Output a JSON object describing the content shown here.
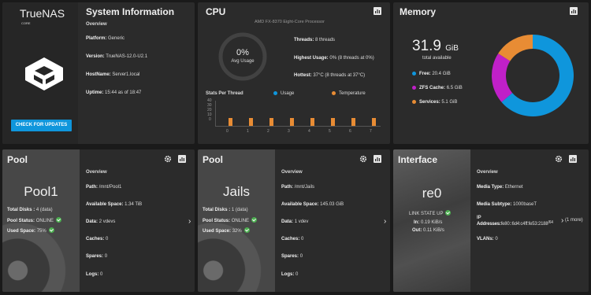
{
  "sysinfo": {
    "title": "System Information",
    "logo_text": "TrueNAS",
    "logo_sub": "CORE",
    "overview": "Overview",
    "platform_label": "Platform:",
    "platform": "Generic",
    "version_label": "Version:",
    "version": "TrueNAS-12.0-U2.1",
    "hostname_label": "HostName:",
    "hostname": "Server1.local",
    "uptime_label": "Uptime:",
    "uptime": "15:44 as of 18:47",
    "check_btn": "CHECK FOR UPDATES"
  },
  "cpu": {
    "title": "CPU",
    "processor": "AMD FX-8370 Eight-Core Processor",
    "gauge_value": "0%",
    "gauge_label": "Avg Usage",
    "threads_label": "Threads:",
    "threads": "8 threads",
    "highest_label": "Highest Usage:",
    "highest": "0%  (8 threads at 0%)",
    "hottest_label": "Hottest:",
    "hottest": "37°C  (8 threads at 37°C)",
    "stats_label": "Stats Per Thread",
    "legend_usage": "Usage",
    "legend_temp": "Temperature",
    "y_ticks": [
      "40",
      "30",
      "20",
      "10",
      "0"
    ],
    "x_ticks": [
      "0",
      "1",
      "2",
      "3",
      "4",
      "5",
      "6",
      "7"
    ]
  },
  "memory": {
    "title": "Memory",
    "total_value": "31.9",
    "total_unit": "GiB",
    "total_label": "total available",
    "free_label": "Free:",
    "free": "20.4 GiB",
    "zfs_label": "ZFS Cache:",
    "zfs": "6.5 GiB",
    "services_label": "Services:",
    "services": "5.1 GiB",
    "colors": {
      "free": "#0f96dc",
      "zfs": "#c020c8",
      "services": "#e88c34"
    },
    "values": [
      20.4,
      6.5,
      5.1
    ]
  },
  "pool1": {
    "title": "Pool",
    "name": "Pool1",
    "total_disks_label": "Total Disks :",
    "total_disks": "4 (data)",
    "status_label": "Pool Status:",
    "status": "ONLINE",
    "used_label": "Used Space:",
    "used": "75%",
    "overview": "Overview",
    "path_label": "Path:",
    "path": "/mnt/Pool1",
    "avail_label": "Available Space:",
    "avail": "1.34 TiB",
    "data_label": "Data:",
    "data": "2 vdevs",
    "caches_label": "Caches:",
    "caches": "0",
    "spares_label": "Spares:",
    "spares": "0",
    "logs_label": "Logs:",
    "logs": "0"
  },
  "pool2": {
    "title": "Pool",
    "name": "Jails",
    "total_disks_label": "Total Disks :",
    "total_disks": "1 (data)",
    "status_label": "Pool Status:",
    "status": "ONLINE",
    "used_label": "Used Space:",
    "used": "32%",
    "overview": "Overview",
    "path_label": "Path:",
    "path": "/mnt/Jails",
    "avail_label": "Available Space:",
    "avail": "145.03 GiB",
    "data_label": "Data:",
    "data": "1 vdev",
    "caches_label": "Caches:",
    "caches": "0",
    "spares_label": "Spares:",
    "spares": "0",
    "logs_label": "Logs:",
    "logs": "0"
  },
  "iface": {
    "title": "Interface",
    "name": "re0",
    "link": "LINK STATE UP",
    "in_label": "In:",
    "in": "0.19 KiB/s",
    "out_label": "Out:",
    "out": "0.11 KiB/s",
    "overview": "Overview",
    "media_type_label": "Media Type:",
    "media_type": "Ethernet",
    "media_sub_label": "Media Subtype:",
    "media_sub": "1000baseT",
    "ip_label": "IP",
    "addr_label": "Addresses:",
    "addr": "fe80::6d4:c4ff:fe53:2188",
    "addr_prefix": "/64",
    "more": "(1 more)",
    "vlans_label": "VLANs:",
    "vlans": "0"
  }
}
